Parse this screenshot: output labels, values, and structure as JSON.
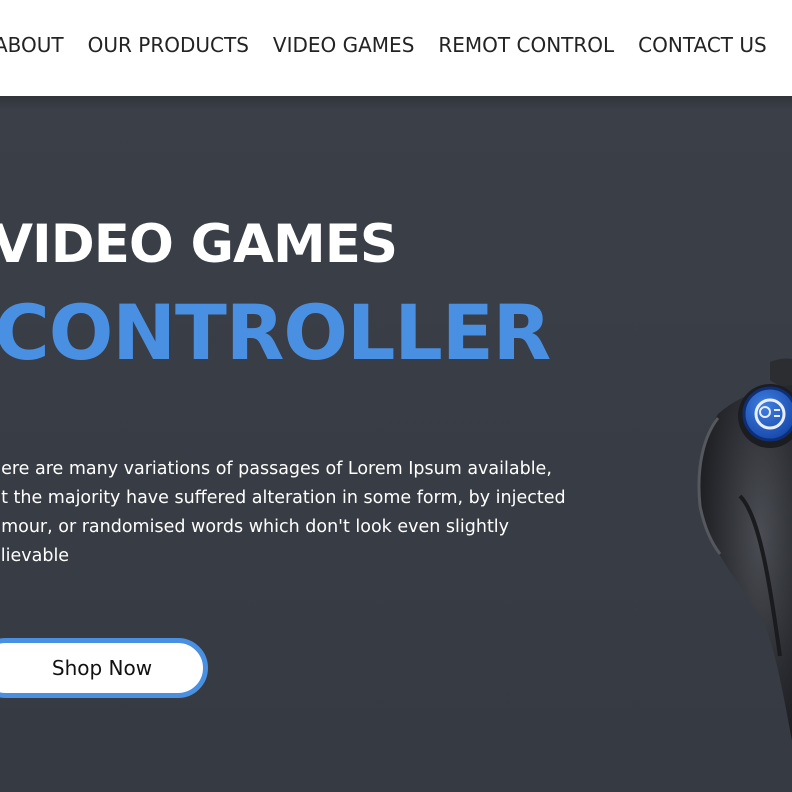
{
  "nav": {
    "items": [
      {
        "label": "ABOUT"
      },
      {
        "label": "OUR PRODUCTS"
      },
      {
        "label": "VIDEO GAMES"
      },
      {
        "label": "REMOT CONTROL"
      },
      {
        "label": "CONTACT US"
      }
    ]
  },
  "hero": {
    "headline_line1": "VIDEO GAMES",
    "headline_line2": "CONTROLLER",
    "description_lines": [
      "here are many variations of passages of Lorem Ipsum available,",
      "ut the majority have suffered alteration in some form, by injected",
      "umour, or randomised words which don't look even slightly",
      "elievable"
    ],
    "cta_label": "Shop Now",
    "image_icon": "game-controller-icon"
  },
  "colors": {
    "accent": "#4a90e2",
    "hero_background": "#3a3e46",
    "nav_background": "#ffffff",
    "nav_text": "#232323"
  }
}
